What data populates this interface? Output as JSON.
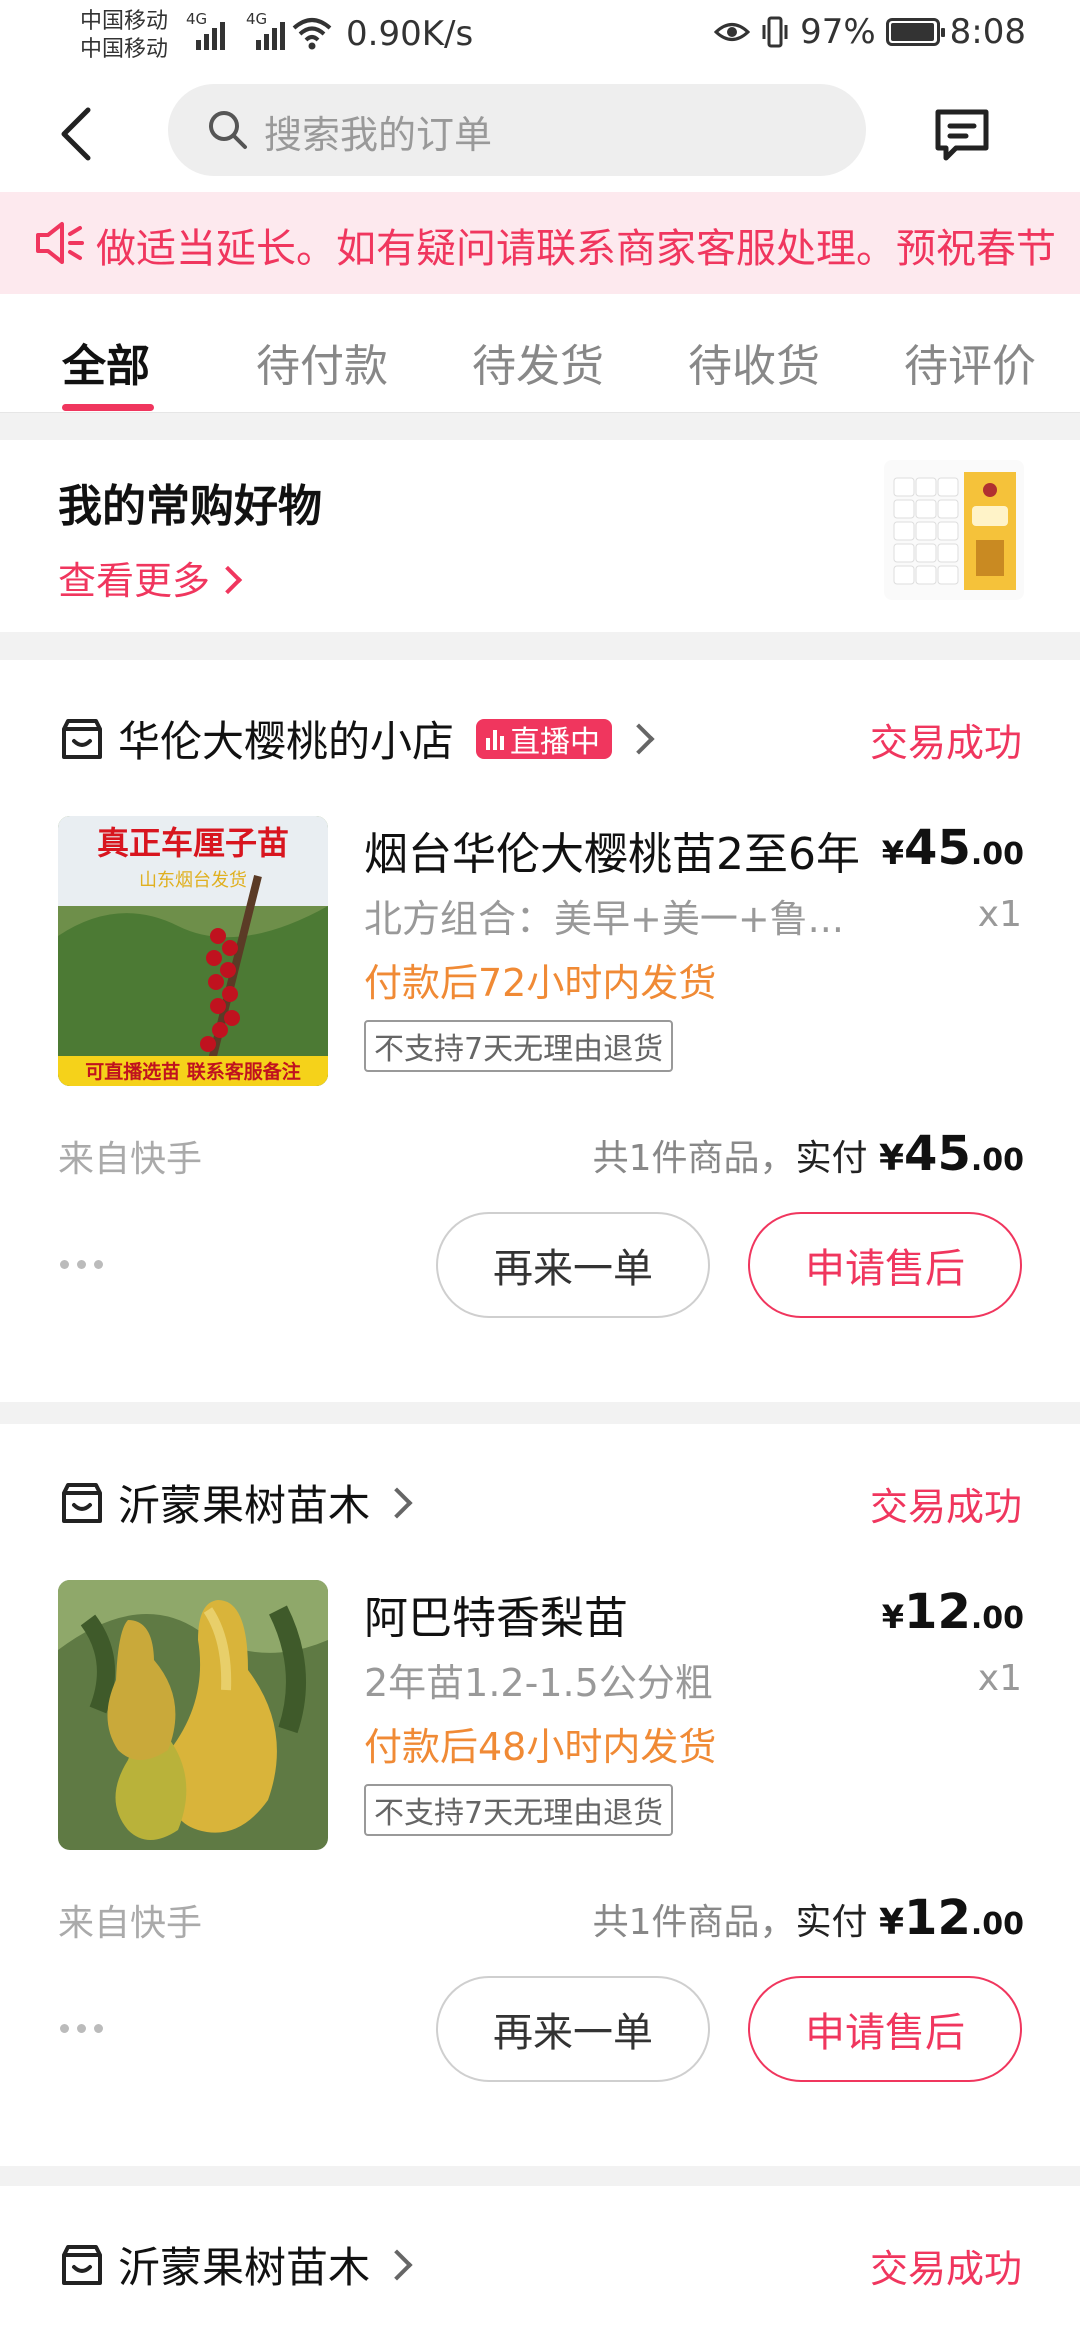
{
  "status_bar": {
    "carrier_1": "中国移动",
    "carrier_2": "中国移动",
    "net_type_1": "4G",
    "net_type_2": "4G",
    "net_speed": "0.90K/s",
    "battery": "97%",
    "battery_level": 0.97,
    "time": "8:08"
  },
  "header": {
    "search_placeholder": "搜索我的订单"
  },
  "notice": {
    "text": "做适当延长。如有疑问请联系商家客服处理。预祝春节"
  },
  "tabs": [
    {
      "label": "全部",
      "active": true
    },
    {
      "label": "待付款",
      "active": false
    },
    {
      "label": "待发货",
      "active": false
    },
    {
      "label": "待收货",
      "active": false
    },
    {
      "label": "待评价",
      "active": false
    }
  ],
  "favorites": {
    "title": "我的常购好物",
    "more_label": "查看更多"
  },
  "orders": [
    {
      "shop_name": "华伦大樱桃的小店",
      "live_badge": "直播中",
      "status": "交易成功",
      "product_name": "烟台华伦大樱桃苗2至6年",
      "spec": "北方组合：美早+美一+鲁...",
      "shipping": "付款后72小时内发货",
      "tag": "不支持7天无理由退货",
      "price_symbol": "¥",
      "price_int": "45",
      "price_dec": ".00",
      "qty": "x1",
      "image_text_1": "真正车厘子苗",
      "image_text_2": "山东烟台发货",
      "image_text_3": "可直播选苗 联系客服备注",
      "source": "来自快手",
      "total_count": "共1件商品，",
      "paid_label": "实付",
      "total_symbol": "¥",
      "total_int": "45",
      "total_dec": ".00",
      "btn_again": "再来一单",
      "btn_aftersale": "申请售后"
    },
    {
      "shop_name": "沂蒙果树苗木",
      "status": "交易成功",
      "product_name": "阿巴特香梨苗",
      "spec": "2年苗1.2-1.5公分粗",
      "shipping": "付款后48小时内发货",
      "tag": "不支持7天无理由退货",
      "price_symbol": "¥",
      "price_int": "12",
      "price_dec": ".00",
      "qty": "x1",
      "source": "来自快手",
      "total_count": "共1件商品，",
      "paid_label": "实付",
      "total_symbol": "¥",
      "total_int": "12",
      "total_dec": ".00",
      "btn_again": "再来一单",
      "btn_aftersale": "申请售后"
    },
    {
      "shop_name": "沂蒙果树苗木",
      "status": "交易成功"
    }
  ],
  "colors": {
    "accent": "#f0365e",
    "shipping_orange": "#f08a35",
    "notice_bg": "#fde9ee"
  }
}
